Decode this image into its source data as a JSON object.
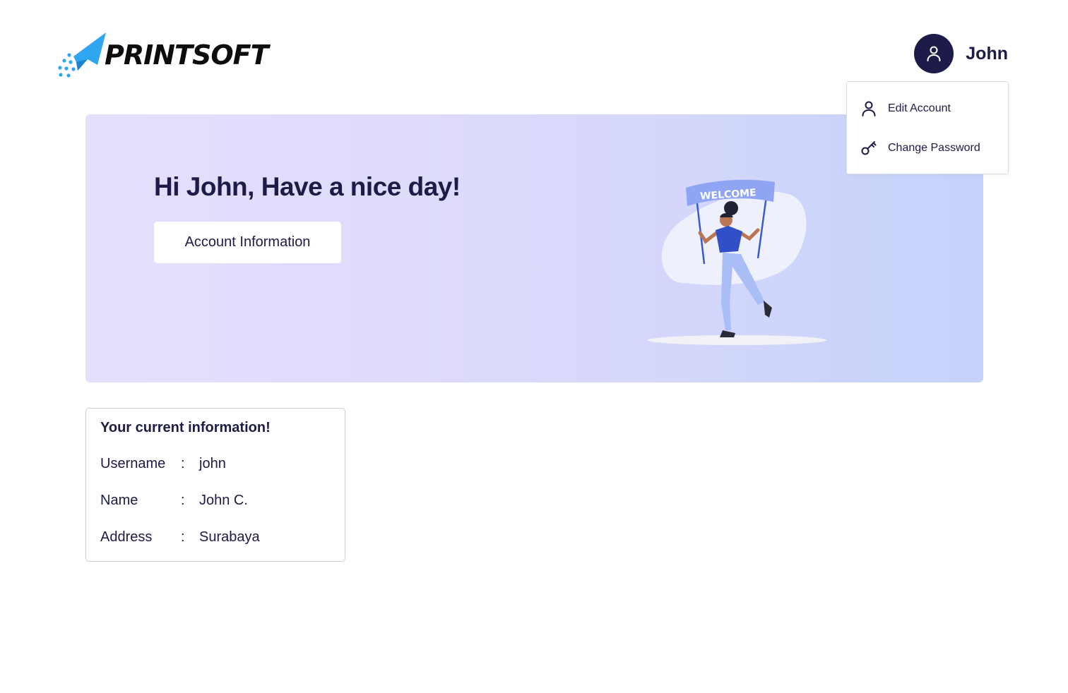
{
  "header": {
    "brand": "PRINTSOFT",
    "user_name": "John",
    "brand_color": "#2fa6ef",
    "avatar_color": "#1d1b47"
  },
  "dropdown": {
    "items": [
      {
        "label": "Edit Account",
        "icon": "user-icon"
      },
      {
        "label": "Change Password",
        "icon": "key-icon"
      }
    ]
  },
  "banner": {
    "greeting": "Hi John, Have a nice day!",
    "button_label": "Account Information",
    "illustration_text": "WELCOME"
  },
  "info": {
    "title": "Your current information!",
    "separator": ":",
    "rows": [
      {
        "label": "Username",
        "value": "john"
      },
      {
        "label": "Name",
        "value": "John C."
      },
      {
        "label": "Address",
        "value": "Surabaya"
      }
    ]
  }
}
